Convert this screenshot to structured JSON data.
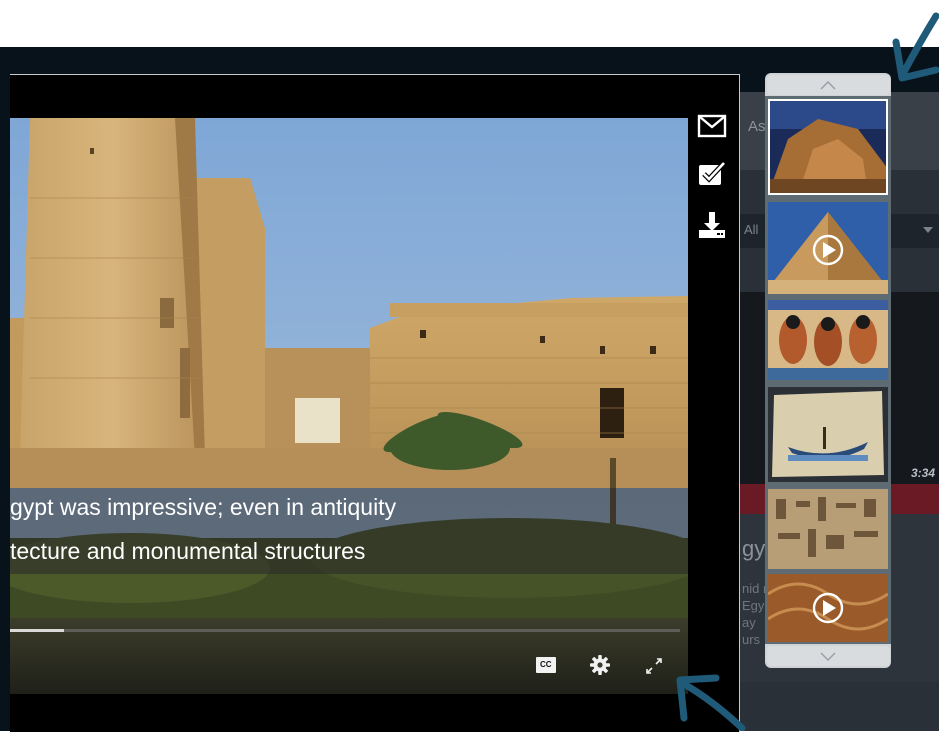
{
  "background_page": {
    "header_text": "Ass          nd to",
    "select_label": "All",
    "video_duration": "3:34",
    "card_title": "gyp        nts",
    "card_desc": "nid          ngs\nEgy           to\nay\nurs"
  },
  "player": {
    "caption_line_1": "gypt was impressive; even in antiquity",
    "caption_line_2": "tecture and monumental structures",
    "progress": 0.08,
    "controls": {
      "cc_label": "CC"
    },
    "side_actions": [
      "email-icon",
      "checkbox-icon",
      "download-icon"
    ]
  },
  "carousel": {
    "thumbnails": [
      {
        "name": "abu-simbel",
        "has_play": false,
        "selected": true
      },
      {
        "name": "pyramid",
        "has_play": true,
        "selected": false
      },
      {
        "name": "tomb-painting",
        "has_play": false,
        "selected": false
      },
      {
        "name": "papyrus-boat",
        "has_play": false,
        "selected": false
      },
      {
        "name": "hieroglyph-relief",
        "has_play": false,
        "selected": false
      },
      {
        "name": "relief-pattern",
        "has_play": true,
        "selected": false
      }
    ]
  },
  "colors": {
    "arrow": "#1f5b78",
    "accent_red": "#6a1a24"
  }
}
